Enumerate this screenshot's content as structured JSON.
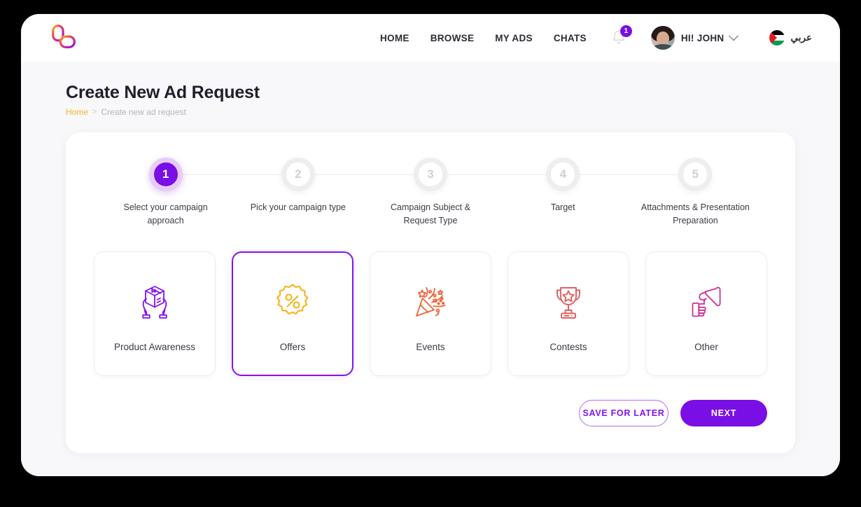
{
  "header": {
    "logo_name": "brand-logo",
    "nav": [
      {
        "label": "HOME"
      },
      {
        "label": "BROWSE"
      },
      {
        "label": "MY ADS"
      },
      {
        "label": "CHATS"
      }
    ],
    "notifications": {
      "icon": "bell-icon",
      "count": "1"
    },
    "user": {
      "greeting": "HI! JOHN",
      "avatar": "user-avatar",
      "chevron": "chevron-down-icon"
    },
    "language": {
      "label": "عربي",
      "flag": "palestine-flag-icon"
    }
  },
  "page": {
    "title": "Create New Ad Request",
    "breadcrumb": {
      "home": "Home",
      "separator": ">",
      "current": "Create new ad request"
    }
  },
  "stepper": {
    "active_step": 1,
    "steps": [
      {
        "number": "1",
        "label": "Select your campaign approach",
        "state": "active"
      },
      {
        "number": "2",
        "label": "Pick your campaign type",
        "state": "inactive"
      },
      {
        "number": "3",
        "label": "Campaign Subject & Request Type",
        "state": "inactive"
      },
      {
        "number": "4",
        "label": "Target",
        "state": "inactive"
      },
      {
        "number": "5",
        "label": "Attachments & Presentation Preparation",
        "state": "inactive"
      }
    ]
  },
  "campaign_options": {
    "selected": "Offers",
    "cards": [
      {
        "label": "Product Awareness",
        "icon": "package-in-hands-icon",
        "color": "#8412f0",
        "selected": false
      },
      {
        "label": "Offers",
        "icon": "percent-badge-icon",
        "color": "#f8b318",
        "selected": true
      },
      {
        "label": "Events",
        "icon": "party-popper-icon",
        "color": "#ef6239",
        "selected": false
      },
      {
        "label": "Contests",
        "icon": "trophy-icon",
        "color": "#dd6161",
        "selected": false
      },
      {
        "label": "Other",
        "icon": "megaphone-in-hand-icon",
        "color": "#c93397",
        "selected": false
      }
    ]
  },
  "actions": {
    "save_label": "SAVE FOR LATER",
    "next_label": "NEXT"
  },
  "colors": {
    "primary_purple": "#7a0fe5",
    "accent_amber": "#f5b324",
    "page_bg": "#f8f8fa"
  }
}
